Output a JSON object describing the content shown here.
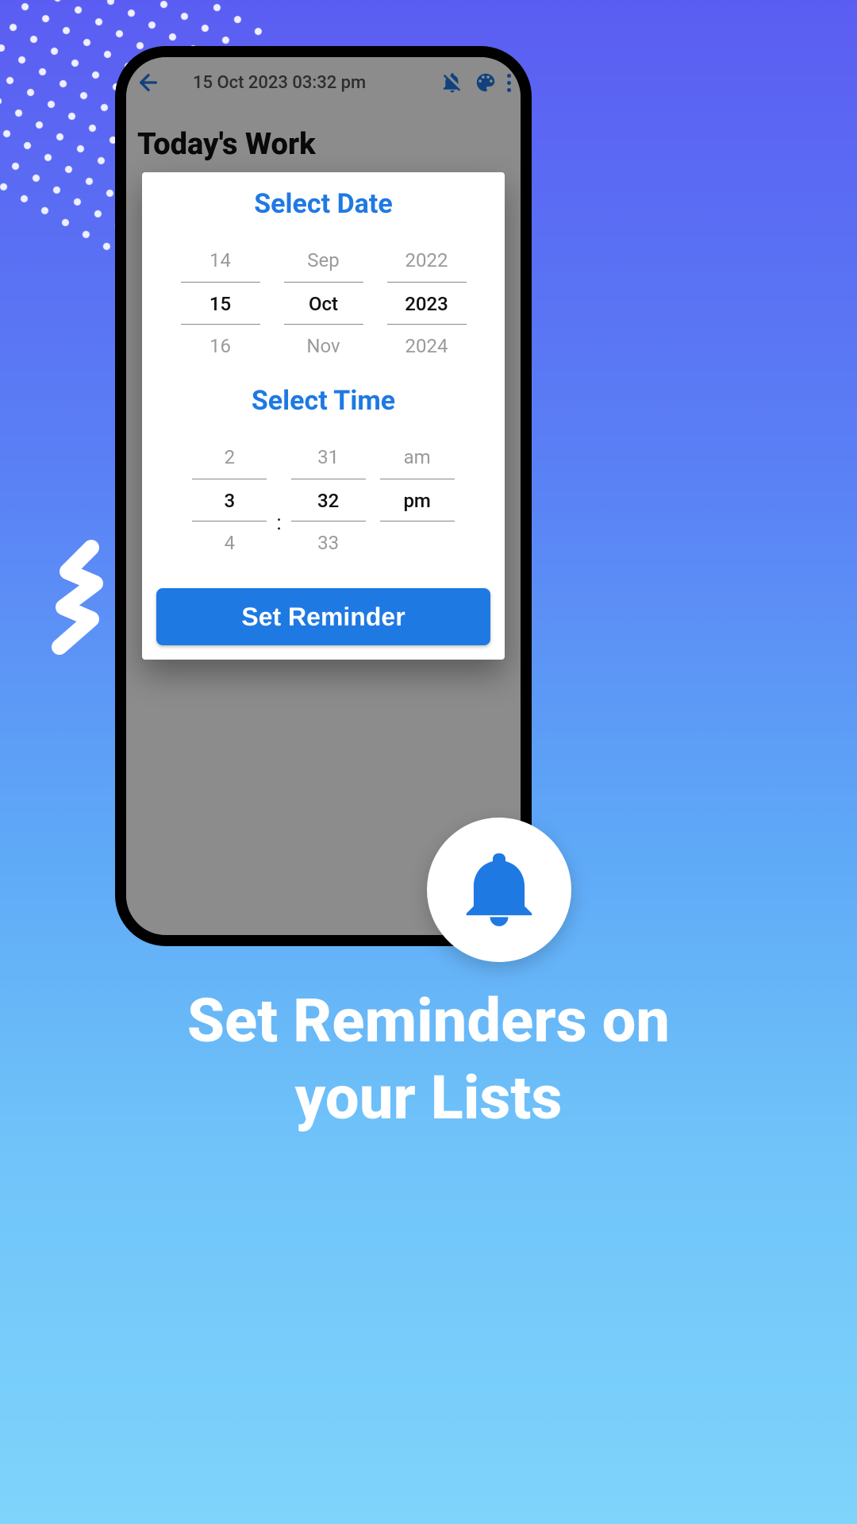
{
  "appbar": {
    "date_time": "15 Oct 2023 03:32 pm"
  },
  "page": {
    "title": "Today's Work"
  },
  "dialog": {
    "date_heading": "Select Date",
    "time_heading": "Select Time",
    "set_button_label": "Set Reminder",
    "date": {
      "day": {
        "prev": "14",
        "cur": "15",
        "next": "16"
      },
      "month": {
        "prev": "Sep",
        "cur": "Oct",
        "next": "Nov"
      },
      "year": {
        "prev": "2022",
        "cur": "2023",
        "next": "2024"
      }
    },
    "time": {
      "hour": {
        "prev": "2",
        "cur": "3",
        "next": "4"
      },
      "minute": {
        "prev": "31",
        "cur": "32",
        "next": "33"
      },
      "ampm": {
        "prev": "am",
        "cur": "pm",
        "next": ""
      },
      "separator": ":"
    }
  },
  "marketing": {
    "line1": "Set Reminders on",
    "line2": "your Lists"
  },
  "colors": {
    "accent": "#1f79e3"
  }
}
